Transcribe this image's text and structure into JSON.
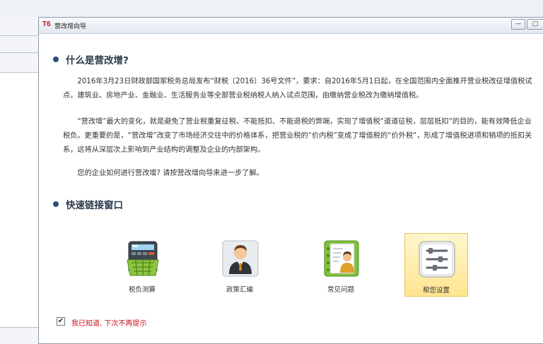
{
  "window": {
    "logo": "T6",
    "title": "营改增向导",
    "min_glyph": "—",
    "max_glyph": "□"
  },
  "sections": {
    "what": {
      "heading": "什么是营改增?"
    },
    "links": {
      "heading": "快速链接窗口"
    }
  },
  "paragraphs": [
    "2016年3月23日财政部国家税务总局发布“财税〔2016〕36号文件”，要求：自2016年5月1日起，在全国范围内全面推开营业税改征增值税试点，建筑业、房地产业、金融业、生活服务业等全部营业税纳税人纳入试点范围，由缴纳营业税改为缴纳增值税。",
    "“营改增”最大的变化，就是避免了营业税重复征税、不能抵扣、不能退税的弊端，实现了增值税“道道征税，层层抵扣”的目的，能有效降低企业税负。更重要的是，“营改增”改变了市场经济交往中的价格体系，把营业税的“价内税”变成了增值税的“价外税”，形成了增值税进项和销项的抵扣关系，这将从深层次上影响到产业结构的调整及企业的内部架构。",
    "您的企业如何进行营改增? 请按营改增向导来进一步了解。"
  ],
  "quick_links": [
    {
      "label": "税负测算",
      "icon": "calculator-basket-icon"
    },
    {
      "label": "政策汇编",
      "icon": "person-icon"
    },
    {
      "label": "常见问题",
      "icon": "notebook-person-icon"
    },
    {
      "label": "帮您设置",
      "icon": "settings-sliders-icon",
      "selected": true
    }
  ],
  "footer": {
    "checkbox_checked": true,
    "check_glyph": "✔",
    "text": "我已知道, 下次不再提示"
  },
  "colors": {
    "accent_red": "#c8141b",
    "heading_dot": "#2d4f7a",
    "selected_bg": "#ffe58f"
  }
}
